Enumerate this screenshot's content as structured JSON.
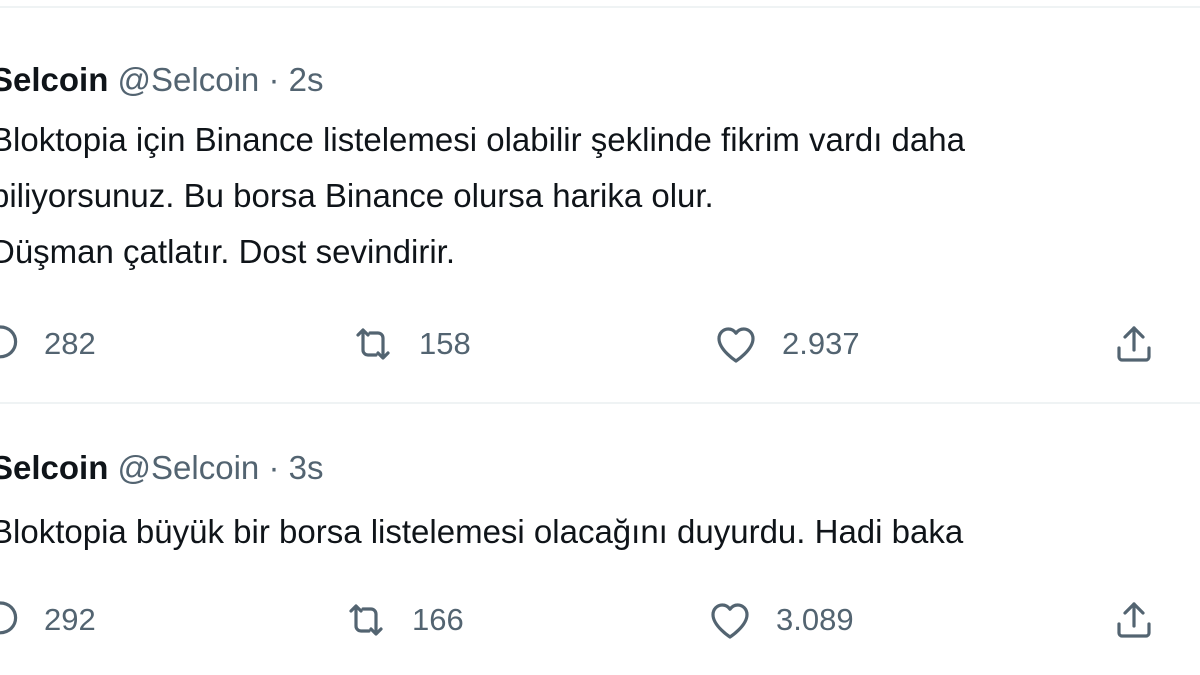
{
  "colors": {
    "text_primary": "#0f1419",
    "text_secondary": "#536471",
    "divider": "#eff3f4"
  },
  "tweets": [
    {
      "author_name": "Selcoin",
      "handle": "@Selcoin",
      "separator": "·",
      "time": "2s",
      "lines": [
        "Bloktopia için Binance listelemesi olabilir şeklinde fikrim vardı daha",
        "biliyorsunuz. Bu borsa Binance olursa harika olur.",
        "Düşman çatlatır. Dost sevindirir."
      ],
      "actions": {
        "reply": {
          "icon": "reply-icon",
          "count": "282"
        },
        "retweet": {
          "icon": "retweet-icon",
          "count": "158"
        },
        "like": {
          "icon": "heart-icon",
          "count": "2.937"
        },
        "share": {
          "icon": "share-icon"
        }
      }
    },
    {
      "author_name": "Selcoin",
      "handle": "@Selcoin",
      "separator": "·",
      "time": "3s",
      "lines": [
        "Bloktopia büyük bir borsa listelemesi olacağını duyurdu. Hadi baka"
      ],
      "actions": {
        "reply": {
          "icon": "reply-icon",
          "count": "292"
        },
        "retweet": {
          "icon": "retweet-icon",
          "count": "166"
        },
        "like": {
          "icon": "heart-icon",
          "count": "3.089"
        },
        "share": {
          "icon": "share-icon"
        }
      }
    }
  ]
}
